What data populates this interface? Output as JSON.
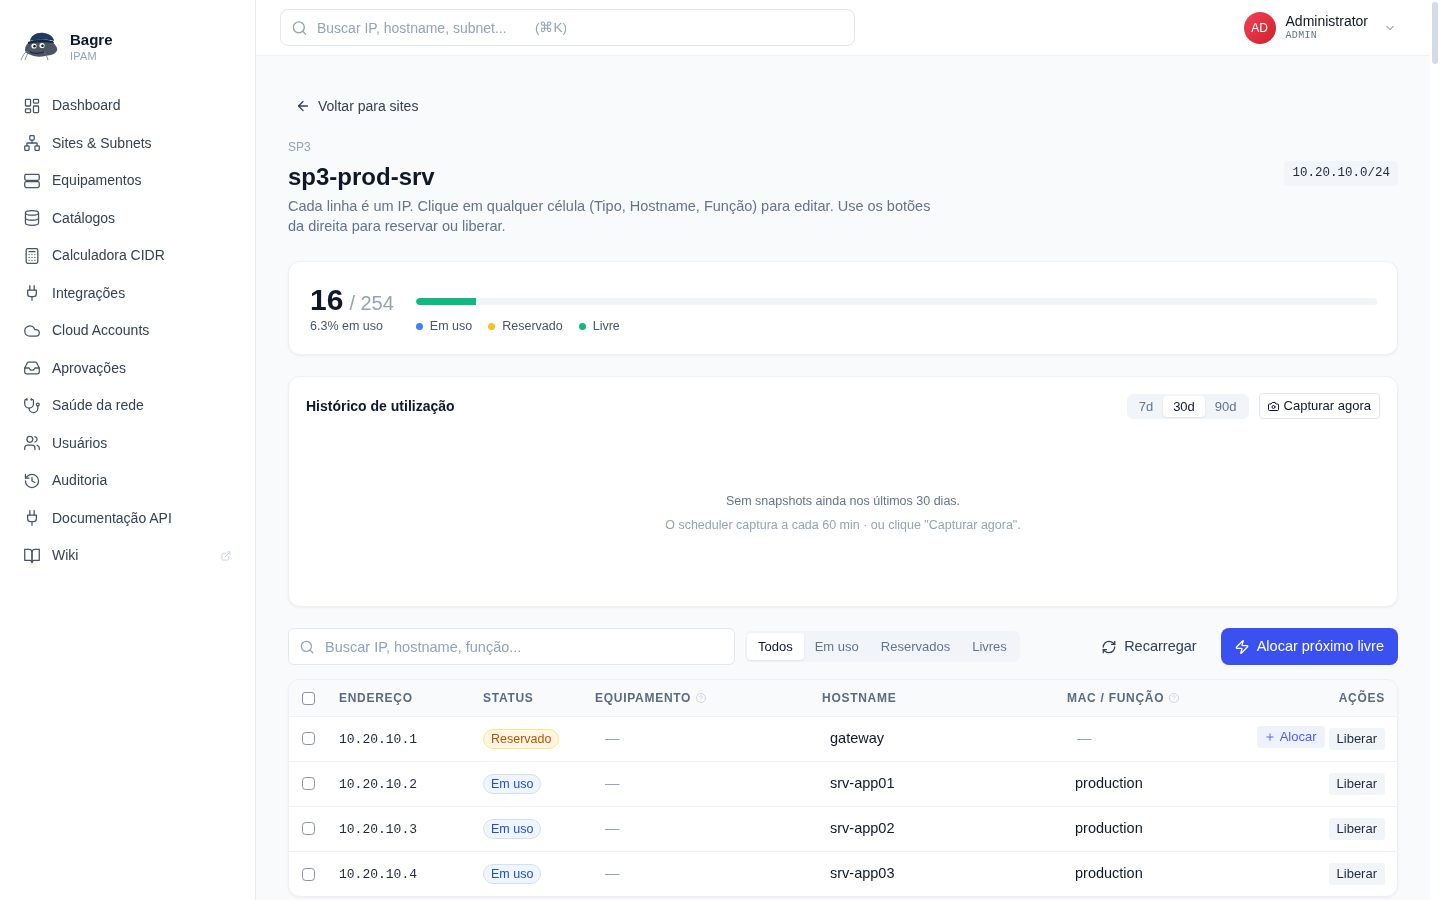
{
  "sidebar": {
    "brand": {
      "name": "Bagre",
      "subtitle": "IPAM"
    },
    "items": [
      {
        "label": "Dashboard",
        "selected": false,
        "external": false
      },
      {
        "label": "Sites & Subnets",
        "selected": false,
        "external": false
      },
      {
        "label": "Equipamentos",
        "selected": false,
        "external": false
      },
      {
        "label": "Catálogos",
        "selected": false,
        "external": false
      },
      {
        "label": "Calculadora CIDR",
        "selected": false,
        "external": false
      },
      {
        "label": "Integrações",
        "selected": false,
        "external": false
      },
      {
        "label": "Cloud Accounts",
        "selected": false,
        "external": false
      },
      {
        "label": "Aprovações",
        "selected": false,
        "external": false
      },
      {
        "label": "Saúde da rede",
        "selected": false,
        "external": false
      },
      {
        "label": "Usuários",
        "selected": false,
        "external": false
      },
      {
        "label": "Auditoria",
        "selected": false,
        "external": false
      },
      {
        "label": "Documentação API",
        "selected": false,
        "external": false
      },
      {
        "label": "Wiki",
        "selected": false,
        "external": true
      }
    ]
  },
  "topbar": {
    "search": {
      "placeholder": "Buscar IP, hostname, subnet...",
      "shortcut": "(⌘K)"
    },
    "user": {
      "initials": "AD",
      "name": "Administrator",
      "role": "ADMIN"
    }
  },
  "header": {
    "back_link": "Voltar para sites",
    "site": "SP3",
    "title": "sp3-prod-srv",
    "description": "Cada linha é um IP. Clique em qualquer célula (Tipo, Hostname, Função) para editar. Use os botões da direita para reservar ou liberar.",
    "cidr": "10.20.10.0/24"
  },
  "usage": {
    "used": "16",
    "total": "/ 254",
    "caption": "6.3% em uso",
    "level": 0.063,
    "legend": [
      {
        "label": "Em uso",
        "color": "#3b82f6"
      },
      {
        "label": "Reservado",
        "color": "#fbbf24"
      },
      {
        "label": "Livre",
        "color": "#10b981"
      }
    ]
  },
  "history": {
    "title": "Histórico de utilização",
    "ranges": [
      {
        "label": "7d",
        "selected": false
      },
      {
        "label": "30d",
        "selected": true
      },
      {
        "label": "90d",
        "selected": false
      }
    ],
    "capture_button": "Capturar agora",
    "empty_title": "Sem snapshots ainda nos últimos 30 dias.",
    "empty_hint": "O scheduler captura a cada 60 min · ou clique \"Capturar agora\"."
  },
  "toolbar": {
    "search": {
      "placeholder": "Buscar IP, hostname, função..."
    },
    "filters": [
      {
        "label": "Todos",
        "selected": true
      },
      {
        "label": "Em uso",
        "selected": false
      },
      {
        "label": "Reservados",
        "selected": false
      },
      {
        "label": "Livres",
        "selected": false
      }
    ],
    "reload_button": "Recarregar",
    "allocate_button": "Alocar próximo livre"
  },
  "table": {
    "select_all": {
      "checked": false
    },
    "columns": [
      {
        "label": "ENDEREÇO",
        "help": false
      },
      {
        "label": "STATUS",
        "help": false
      },
      {
        "label": "EQUIPAMENTO",
        "help": true
      },
      {
        "label": "HOSTNAME",
        "help": false
      },
      {
        "label": "MAC / FUNÇÃO",
        "help": true
      },
      {
        "label": "AÇÕES",
        "help": false
      }
    ],
    "rows": [
      {
        "checked": false,
        "address": "10.20.10.1",
        "status": {
          "label": "Reservado",
          "kind": "reserved"
        },
        "equipment": {
          "text": "—",
          "muted": true
        },
        "hostname": "gateway",
        "mac_function": {
          "text": "—",
          "muted": true
        },
        "actions": [
          {
            "label": "Alocar",
            "kind": "allocate"
          },
          {
            "label": "Liberar",
            "kind": "release"
          }
        ]
      },
      {
        "checked": false,
        "address": "10.20.10.2",
        "status": {
          "label": "Em uso",
          "kind": "in_use"
        },
        "equipment": {
          "text": "—",
          "muted": true
        },
        "hostname": "srv-app01",
        "mac_function": {
          "text": "production",
          "muted": false
        },
        "actions": [
          {
            "label": "Liberar",
            "kind": "release"
          }
        ]
      },
      {
        "checked": false,
        "address": "10.20.10.3",
        "status": {
          "label": "Em uso",
          "kind": "in_use"
        },
        "equipment": {
          "text": "—",
          "muted": true
        },
        "hostname": "srv-app02",
        "mac_function": {
          "text": "production",
          "muted": false
        },
        "actions": [
          {
            "label": "Liberar",
            "kind": "release"
          }
        ]
      },
      {
        "checked": false,
        "address": "10.20.10.4",
        "status": {
          "label": "Em uso",
          "kind": "in_use"
        },
        "equipment": {
          "text": "—",
          "muted": true
        },
        "hostname": "srv-app03",
        "mac_function": {
          "text": "production",
          "muted": false
        },
        "actions": [
          {
            "label": "Liberar",
            "kind": "release"
          }
        ]
      }
    ]
  }
}
